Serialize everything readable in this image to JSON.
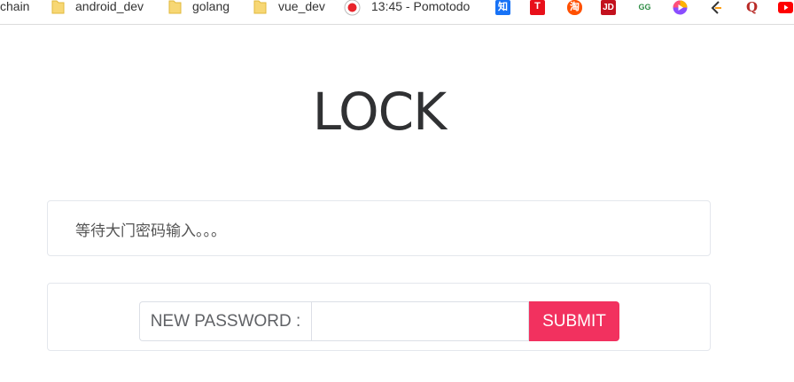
{
  "bookmarks": {
    "items": [
      {
        "label": "chain"
      },
      {
        "label": "android_dev",
        "icon": "folder-icon"
      },
      {
        "label": "golang",
        "icon": "folder-icon"
      },
      {
        "label": "vue_dev",
        "icon": "folder-icon"
      },
      {
        "label": "13:45 - Pomotodo",
        "icon": "pomotodo-icon"
      }
    ],
    "favicons": [
      {
        "icon": "zhihu-icon",
        "text": "知",
        "color": "#1772f6"
      },
      {
        "icon": "toutiao-icon",
        "text": "T",
        "color": "#e8101a"
      },
      {
        "icon": "taobao-icon",
        "text": "淘",
        "color": "#ff5000"
      },
      {
        "icon": "jd-icon",
        "text": "JD",
        "color": "#c3111e"
      },
      {
        "icon": "geeksforgeeks-icon",
        "text": "GG",
        "color": "#2f8d46"
      },
      {
        "icon": "colorful-play-icon",
        "text": "",
        "color": "#8a4dff"
      },
      {
        "icon": "leetcode-icon",
        "text": "",
        "color": "#ffa116"
      },
      {
        "icon": "quora-icon",
        "text": "Q",
        "color": "#b92b27"
      },
      {
        "icon": "youtube-icon",
        "text": "",
        "color": "#ff0000"
      }
    ]
  },
  "page": {
    "title": "LOCK",
    "status_message": "等待大门密码输入。。。",
    "form": {
      "prefix_label": "NEW PASSWORD :",
      "password_value": "",
      "password_placeholder": "",
      "submit_label": "SUBMIT"
    }
  },
  "colors": {
    "accent": "#f2315f",
    "title": "#303133",
    "border": "#e4e7ed"
  }
}
